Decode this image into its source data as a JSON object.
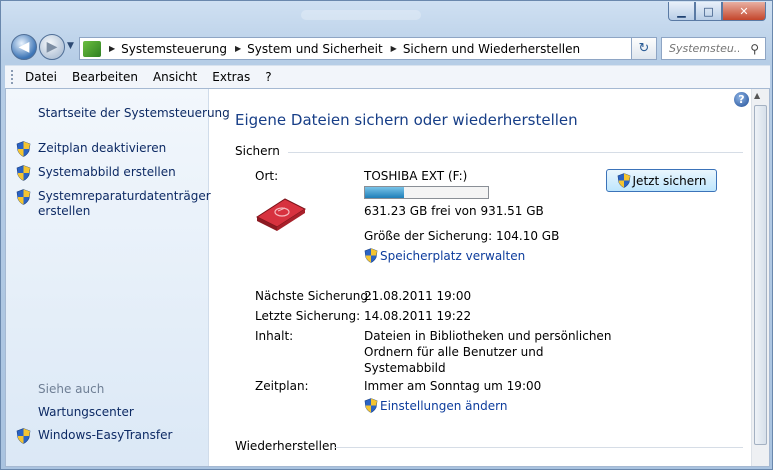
{
  "nav": {
    "breadcrumbs": [
      "Systemsteuerung",
      "System und Sicherheit",
      "Sichern und Wiederherstellen"
    ],
    "search_placeholder": "Systemsteu..."
  },
  "menu": [
    "Datei",
    "Bearbeiten",
    "Ansicht",
    "Extras",
    "?"
  ],
  "sidebar": {
    "home_link": "Startseite der Systemsteuerung",
    "tasks": [
      "Zeitplan deaktivieren",
      "Systemabbild erstellen",
      "Systemreparaturdatenträger erstellen"
    ],
    "see_also_label": "Siehe auch",
    "see_also": [
      "Wartungscenter",
      "Windows-EasyTransfer"
    ]
  },
  "main": {
    "title": "Eigene Dateien sichern oder wiederherstellen",
    "backup_group": "Sichern",
    "location_label": "Ort:",
    "drive_name": "TOSHIBA EXT (F:)",
    "drive_used_fraction": 0.32,
    "free_space": "631.23 GB frei von 931.51 GB",
    "backup_size": "Größe der Sicherung: 104.10 GB",
    "manage_space_link": "Speicherplatz verwalten",
    "backup_now_button": "Jetzt sichern",
    "next_backup_label": "Nächste Sicherung:",
    "next_backup_value": "21.08.2011 19:00",
    "last_backup_label": "Letzte Sicherung:",
    "last_backup_value": "14.08.2011 19:22",
    "contents_label": "Inhalt:",
    "contents_value_lines": [
      "Dateien in Bibliotheken und persönlichen",
      "Ordnern für alle Benutzer und",
      "Systemabbild"
    ],
    "schedule_label": "Zeitplan:",
    "schedule_value": "Immer am Sonntag um 19:00",
    "change_settings_link": "Einstellungen ändern",
    "restore_group": "Wiederherstellen"
  }
}
